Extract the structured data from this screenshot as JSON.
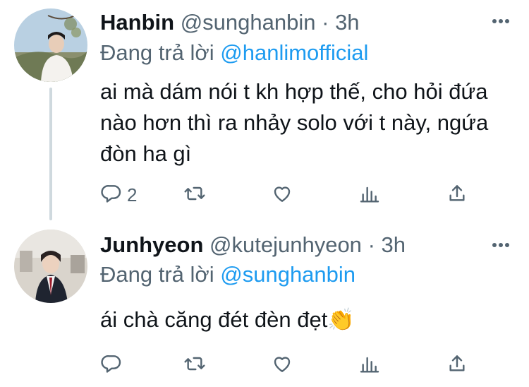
{
  "tweets": [
    {
      "name": "Hanbin",
      "handle": "@sunghanbin",
      "dot": "·",
      "time": "3h",
      "replying_prefix": "Đang trả lời",
      "replying_to": "@hanlimofficial",
      "text": "ai mà dám nói t kh hợp thế, cho hỏi đứa nào hơn thì ra nhảy solo với t này, ngứa đòn ha gì",
      "reply_count": "2",
      "retweet_count": "",
      "like_count": ""
    },
    {
      "name": "Junhyeon",
      "handle": "@kutejunhyeon",
      "dot": "·",
      "time": "3h",
      "replying_prefix": "Đang trả lời",
      "replying_to": "@sunghanbin",
      "text": "ái chà căng đét đèn đẹt👏",
      "reply_count": "",
      "retweet_count": "",
      "like_count": ""
    }
  ],
  "icons": {
    "reply": "reply-icon",
    "retweet": "retweet-icon",
    "like": "heart-icon",
    "stats": "analytics-icon",
    "share": "share-icon",
    "more": "more-icon"
  },
  "colors": {
    "text": "#0f1419",
    "muted": "#536471",
    "mention": "#1d9bf0",
    "thread_line": "#cfd9de"
  }
}
